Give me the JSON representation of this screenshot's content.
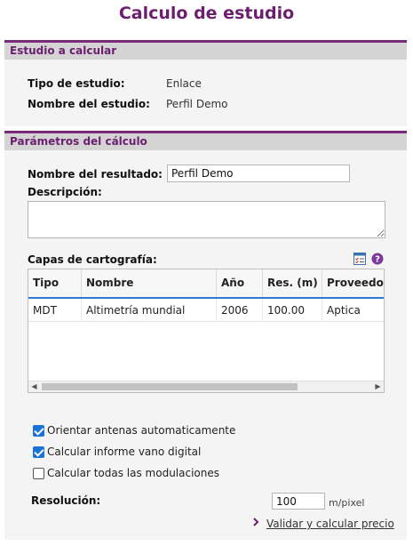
{
  "title": "Calculo de estudio",
  "study_section": {
    "header": "Estudio a calcular",
    "type_label": "Tipo de estudio:",
    "type_value": "Enlace",
    "name_label": "Nombre del estudio:",
    "name_value": "Perfil Demo"
  },
  "params_section": {
    "header": "Parámetros del cálculo",
    "result_name_label": "Nombre del resultado:",
    "result_name_value": "Perfil Demo",
    "description_label": "Descripción:",
    "description_value": "",
    "layers_label": "Capas de cartografía:",
    "table": {
      "columns": [
        "Tipo",
        "Nombre",
        "Año",
        "Res. (m)",
        "Proveedor"
      ],
      "rows": [
        [
          "MDT",
          "Altimetría mundial",
          "2006",
          "100.00",
          "Aptica"
        ]
      ]
    },
    "options": [
      {
        "label": "Orientar antenas automaticamente",
        "checked": true
      },
      {
        "label": "Calcular informe vano digital",
        "checked": true
      },
      {
        "label": "Calcular todas las modulaciones",
        "checked": false
      }
    ],
    "resolution_label": "Resolución:",
    "resolution_value": "100",
    "resolution_unit": "m/pixel",
    "validate_link": "Validar y calcular precio"
  },
  "colors": {
    "title": "#6b1f6e",
    "header_bar": "#d4d4d4",
    "header_accent": "#7a2a7c",
    "checkbox": "#1a73d9"
  },
  "icons": [
    "checklist-icon",
    "help-icon",
    "chevron-right-icon",
    "scroll-left-icon",
    "scroll-right-icon"
  ]
}
